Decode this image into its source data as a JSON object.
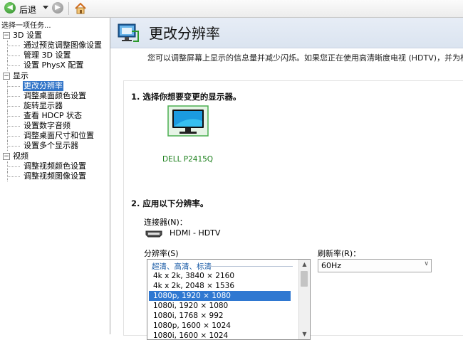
{
  "toolbar": {
    "back_label": "后退"
  },
  "sidebar": {
    "header": "选择一项任务...",
    "groups": [
      {
        "label": "3D 设置",
        "toggle": "−",
        "items": [
          "通过预览调整图像设置",
          "管理 3D 设置",
          "设置 PhysX 配置"
        ]
      },
      {
        "label": "显示",
        "toggle": "−",
        "items": [
          "更改分辨率",
          "调整桌面颜色设置",
          "旋转显示器",
          "查看 HDCP 状态",
          "设置数字音频",
          "调整桌面尺寸和位置",
          "设置多个显示器"
        ]
      },
      {
        "label": "视频",
        "toggle": "−",
        "items": [
          "调整视频颜色设置",
          "调整视频图像设置"
        ]
      }
    ],
    "selected": "更改分辨率"
  },
  "main": {
    "title": "更改分辨率",
    "description": "您可以调整屏幕上显示的信息量并减少闪烁。如果您正在使用高清晰度电视 (HDTV)，并为标",
    "step1": {
      "heading": "1.  选择你想要变更的显示器。",
      "display_name": "DELL P2415Q"
    },
    "step2": {
      "heading": "2.  应用以下分辨率。",
      "connector_label": "连接器(N)：",
      "connector_value": "HDMI - HDTV",
      "resolution_label": "分辨率(S)",
      "refresh_label": "刷新率(R)：",
      "refresh_value": "60Hz",
      "group_header": "超清、高清、标清",
      "resolutions": [
        "4k x 2k, 3840 × 2160",
        "4k x 2k, 2048 × 1536",
        "1080p, 1920 × 1080",
        "1080i, 1920 × 1080",
        "1080i, 1768 × 992",
        "1080p, 1600 × 1024",
        "1080i, 1600 × 1024"
      ],
      "selected_resolution": "1080p, 1920 × 1080"
    }
  },
  "colors": {
    "selection": "#3275c8",
    "title_bar": "#dbe4f0",
    "display_label": "#1a7f1a"
  }
}
